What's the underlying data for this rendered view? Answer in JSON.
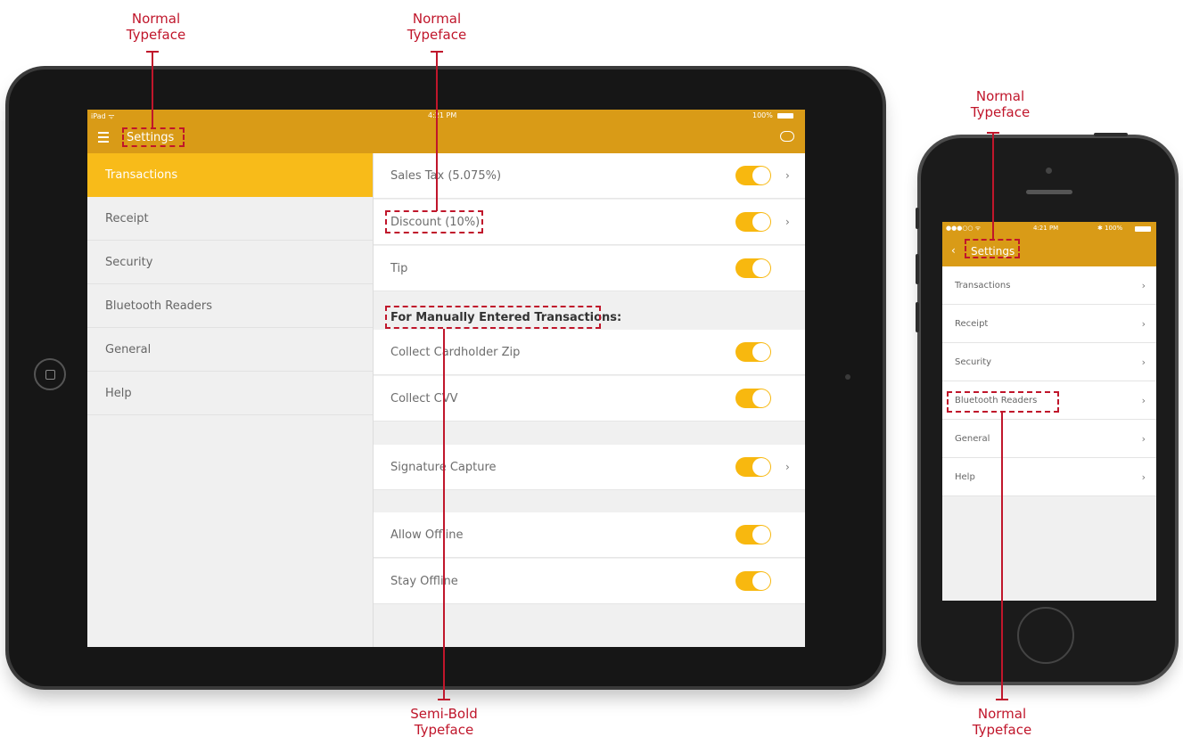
{
  "annotations": {
    "settings_title_ipad": "Normal\nTypeface",
    "discount_row": "Normal\nTypeface",
    "settings_title_iphone": "Normal\nTypeface",
    "section_header": "Semi-Bold\nTypeface",
    "bluetooth_readers_iphone": "Normal\nTypeface"
  },
  "ipad": {
    "status": {
      "carrier": "iPad ᯤ",
      "time": "4:21 PM",
      "battery": "100%"
    },
    "nav": {
      "title": "Settings",
      "menu_icon": "hamburger-icon",
      "chat_icon": "chat-bubble-icon"
    },
    "sidebar": [
      {
        "label": "Transactions",
        "active": true
      },
      {
        "label": "Receipt",
        "active": false
      },
      {
        "label": "Security",
        "active": false
      },
      {
        "label": "Bluetooth Readers",
        "active": false
      },
      {
        "label": "General",
        "active": false
      },
      {
        "label": "Help",
        "active": false
      }
    ],
    "rows": [
      {
        "label": "Sales Tax (5.075%)",
        "toggle_on": true,
        "chevron": "›"
      },
      {
        "label": "Discount (10%)",
        "toggle_on": true,
        "chevron": "›"
      },
      {
        "label": "Tip",
        "toggle_on": true
      },
      {
        "label": "Collect Cardholder Zip",
        "toggle_on": true
      },
      {
        "label": "Collect CVV",
        "toggle_on": true
      },
      {
        "label": "Signature Capture",
        "toggle_on": true,
        "chevron": "›"
      },
      {
        "label": "Allow Offline",
        "toggle_on": true
      },
      {
        "label": "Stay Offline",
        "toggle_on": true
      }
    ],
    "section_header": "For Manually  Entered Transactions:"
  },
  "iphone": {
    "status": {
      "carrier": "●●●○○ ᯤ",
      "time": "4:21 PM",
      "battery": "✱ 100%"
    },
    "nav": {
      "back": "‹",
      "title": "Settings"
    },
    "items": [
      {
        "label": "Transactions",
        "chevron": "›"
      },
      {
        "label": "Receipt",
        "chevron": "›"
      },
      {
        "label": "Security",
        "chevron": "›"
      },
      {
        "label": "Bluetooth Readers",
        "chevron": "›"
      },
      {
        "label": "General",
        "chevron": "›"
      },
      {
        "label": "Help",
        "chevron": "›"
      }
    ]
  },
  "colors": {
    "nav_bar": "#d99b17",
    "accent": "#f8bb19",
    "annotation": "#c0162b"
  }
}
